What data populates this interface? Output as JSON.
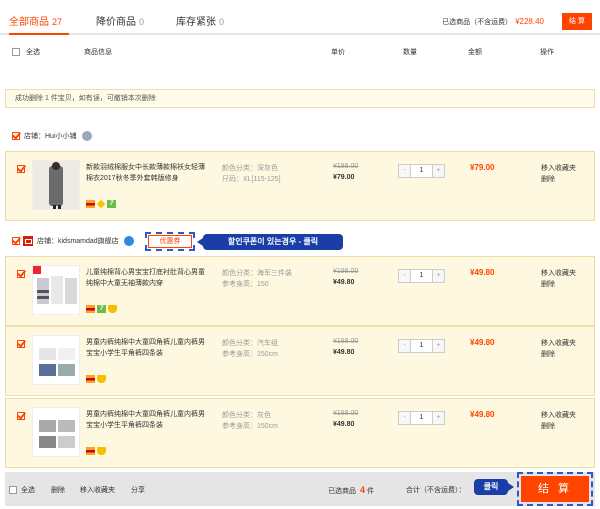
{
  "tabs": [
    {
      "label": "全部商品",
      "count": "27"
    },
    {
      "label": "降价商品",
      "count": "0"
    },
    {
      "label": "库存紧张",
      "count": "0"
    }
  ],
  "summary": {
    "label": "已选商品（不含运费）",
    "amount": "¥228.40",
    "settle": "结 算"
  },
  "columns": {
    "select_all": "全选",
    "info": "商品信息",
    "price": "单价",
    "qty": "数量",
    "amount": "金额",
    "ops": "操作"
  },
  "notice": "成功删除 1 件宝贝，如有误，可撤销本次删除",
  "shops": [
    {
      "label": "店铺：",
      "name": "Hui小小铺"
    },
    {
      "label": "店铺：",
      "name": "kidsmamdad旗舰店",
      "coupon": "优惠券"
    }
  ],
  "items": [
    {
      "title": "新款羽绒棉服女中长款薄款棉袄女轻薄棉衣2017秋冬季外套韩版修身",
      "attr1": "颜色分类：深灰色",
      "attr2": "尺码：XL[115-125]",
      "orig": "¥188.00",
      "price": "¥79.00",
      "qty": "1",
      "sum": "¥79.00",
      "op1": "移入收藏夹",
      "op2": "删除",
      "badge7": "7"
    },
    {
      "title": "儿童纯棉背心男宝宝打底衬肚背心男童纯棉中大童无袖薄款内穿",
      "attr1": "颜色分类：海军三件装",
      "attr2": "参考身高：150",
      "orig": "¥198.00",
      "price": "¥49.80",
      "qty": "1",
      "sum": "¥49.80",
      "op1": "移入收藏夹",
      "op2": "删除",
      "badge7": "7"
    },
    {
      "title": "男童内裤纯棉中大童四角裤儿童内裤男宝宝小学生平角裤四条装",
      "attr1": "颜色分类：汽车组",
      "attr2": "参考身高：150cm",
      "orig": "¥189.00",
      "price": "¥49.80",
      "qty": "1",
      "sum": "¥49.80",
      "op1": "移入收藏夹",
      "op2": "删除"
    },
    {
      "title": "男童内裤纯棉中大童四角裤儿童内裤男宝宝小学生平角裤四条装",
      "attr1": "颜色分类：灰色",
      "attr2": "参考身高：150cm",
      "orig": "¥189.00",
      "price": "¥49.80",
      "qty": "1",
      "sum": "¥49.80",
      "op1": "移入收藏夹",
      "op2": "删除"
    }
  ],
  "callouts": {
    "coupon": "할인쿠폰이 있는경우 - 클릭",
    "settle": "클릭"
  },
  "bottom": {
    "select_all": "全选",
    "delete": "删除",
    "fav": "移入收藏夹",
    "share": "分享",
    "selected_prefix": "已选商品",
    "selected_count": "4",
    "selected_suffix": "件",
    "total_label": "合计（不含运费）：",
    "settle": "结 算"
  },
  "colors": {
    "accent": "#ff4400",
    "annotation": "#1a3ea8",
    "item_bg": "#fff8e1"
  }
}
